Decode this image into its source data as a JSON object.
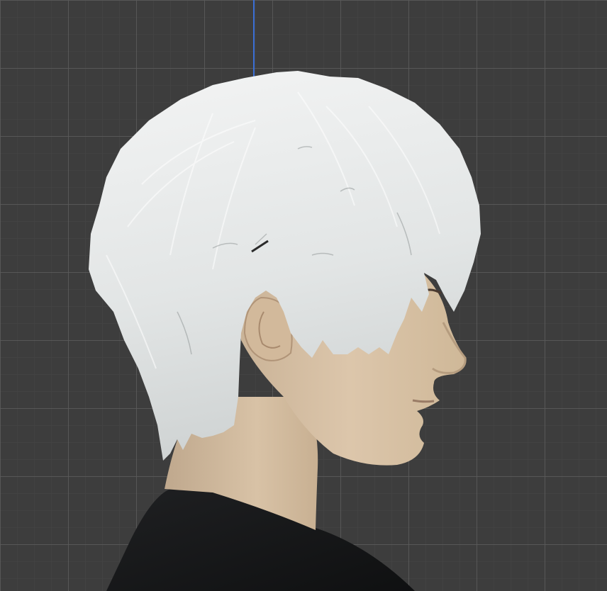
{
  "viewport": {
    "background_color": "#3d3d3d",
    "grid_major_color": "#5a5a5a",
    "grid_minor_color": "#464646",
    "axis_color": "#3b6fd6",
    "axis_icon": "z-axis-line"
  },
  "model": {
    "subject": "3d-character-head-profile",
    "hair_color": "#e6e8e8",
    "skin_color": "#d8c2a8",
    "shirt_color": "#151617"
  }
}
